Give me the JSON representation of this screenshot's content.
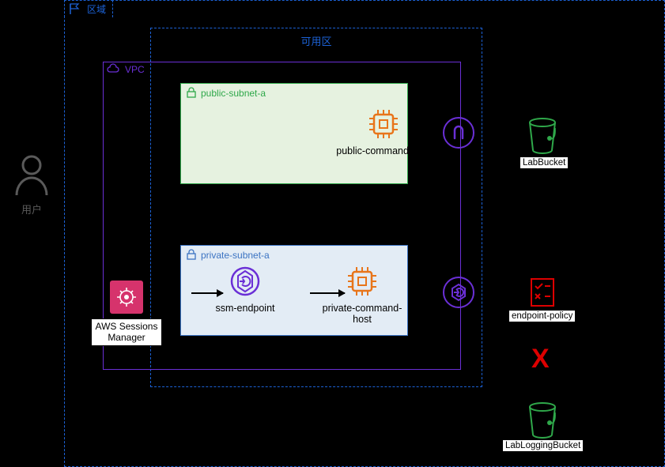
{
  "user_label": "用户",
  "region": {
    "label": "区域"
  },
  "az": {
    "label": "可用区"
  },
  "vpc": {
    "label": "VPC"
  },
  "public_subnet": {
    "label": "public-subnet-a",
    "host_label": "public-command-host"
  },
  "private_subnet": {
    "label": "private-subnet-a",
    "host_label": "private-command-host",
    "endpoint_label": "ssm-endpoint"
  },
  "ssm_manager": {
    "label": "AWS Sessions Manager"
  },
  "buckets": {
    "lab": "LabBucket",
    "logging": "LabLoggingBucket"
  },
  "policy": {
    "label": "endpoint-policy"
  },
  "deny_mark": "X",
  "icons": {
    "flag": "flag-icon",
    "cloud": "cloud-icon",
    "lock": "lock-icon",
    "ec2": "ec2-chip-icon",
    "ssm_endpoint": "ssm-endpoint-icon",
    "ssm_manager": "aws-systems-manager-icon",
    "gateway": "internet-gateway-icon",
    "vpc_endpoint": "vpc-endpoint-icon",
    "bucket": "s3-bucket-icon",
    "policy": "policy-document-icon",
    "user": "user-icon"
  },
  "colors": {
    "region_blue": "#1c62d6",
    "vpc_purple": "#6a2fd6",
    "subnet_green": "#2fa84a",
    "subnet_blue": "#3b73c2",
    "ec2_orange": "#e8751a",
    "bucket_green": "#2fa84a",
    "ssm_pink": "#d6336c",
    "deny_red": "#dd0000"
  }
}
